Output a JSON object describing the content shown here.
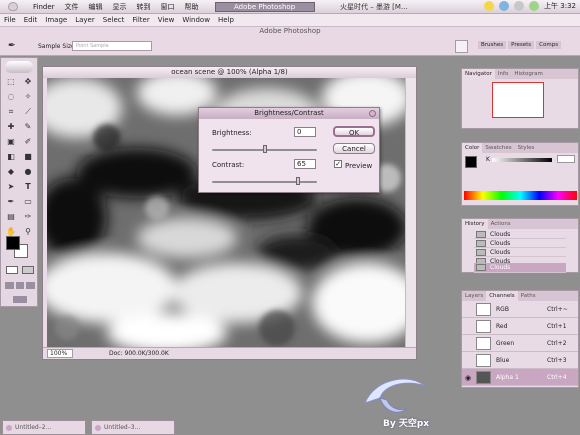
{
  "macbar": {
    "menus": [
      "Finder",
      "文件",
      "编辑",
      "显示",
      "转到",
      "窗口",
      "帮助"
    ],
    "task_app": "Adobe Photoshop",
    "task_other": "火星时代 – 墨游 [M...",
    "clock": "上午 3:32"
  },
  "window_title": "Adobe Photoshop",
  "menubar": [
    "File",
    "Edit",
    "Image",
    "Layer",
    "Select",
    "Filter",
    "View",
    "Window",
    "Help"
  ],
  "options": {
    "sample_size_label": "Sample Size:",
    "sample_size_value": "Point Sample"
  },
  "top_tabs": [
    "Brushes",
    "Presets",
    "Comps"
  ],
  "document": {
    "title": "ocean scene @ 100% (Alpha 1/8)",
    "zoom": "100%",
    "doc_size": "Doc: 900.0K/300.0K"
  },
  "dialog": {
    "title": "Brightness/Contrast",
    "brightness_label": "Brightness:",
    "brightness_value": "0",
    "brightness_level": 0.5,
    "contrast_label": "Contrast:",
    "contrast_value": "65",
    "contrast_level": 0.82,
    "ok": "OK",
    "cancel": "Cancel",
    "preview": "Preview",
    "preview_checked": "✓"
  },
  "panels": {
    "navigator_tabs": [
      "Navigator",
      "Info",
      "Histogram"
    ],
    "color_tabs": [
      "Color",
      "Swatches",
      "Styles"
    ],
    "color_k": "K",
    "history_tabs": [
      "History",
      "Actions"
    ],
    "history_items": [
      "Clouds",
      "Clouds",
      "Clouds",
      "Clouds",
      "Clouds"
    ],
    "channels_tabs": [
      "Layers",
      "Channels",
      "Paths"
    ],
    "channels": [
      {
        "name": "RGB",
        "key": "Ctrl+~"
      },
      {
        "name": "Red",
        "key": "Ctrl+1"
      },
      {
        "name": "Green",
        "key": "Ctrl+2"
      },
      {
        "name": "Blue",
        "key": "Ctrl+3"
      },
      {
        "name": "Alpha 1",
        "key": "Ctrl+4"
      }
    ]
  },
  "minimized": [
    "Untitled–2...",
    "Untitled–3..."
  ],
  "logo_text": "By 天空px",
  "colors": {
    "accent": "#c9a6c1",
    "chrome": "#e9dbe6"
  }
}
